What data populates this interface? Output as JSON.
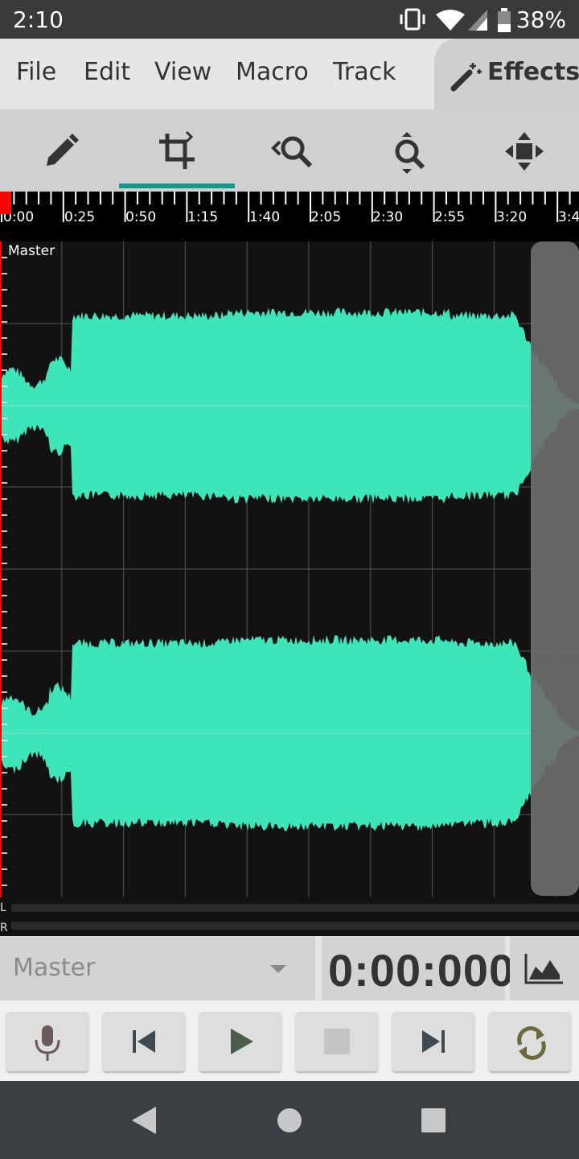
{
  "status_bar": {
    "time": "2:10",
    "battery": "38%"
  },
  "menu": {
    "items": [
      "File",
      "Edit",
      "View",
      "Macro",
      "Track"
    ],
    "effects_label": "Effects"
  },
  "toolbar": {
    "tools": [
      "pencil-icon",
      "crop-icon",
      "zoom-horizontal-icon",
      "zoom-vertical-icon",
      "move-icon"
    ],
    "active_tool_index": 1
  },
  "timeline": {
    "labels": [
      "0:00",
      "0:25",
      "0:50",
      "1:15",
      "1:40",
      "2:05",
      "2:30",
      "2:55",
      "3:20",
      "3:4"
    ]
  },
  "track": {
    "name": "Master"
  },
  "meters": {
    "left": "L",
    "right": "R"
  },
  "controls": {
    "track_select": "Master",
    "time": "0:00:000"
  },
  "transport": [
    "mic-icon",
    "skip-start-icon",
    "play-icon",
    "stop-icon",
    "skip-end-icon",
    "loop-icon"
  ],
  "colors": {
    "waveform": "#3de6b8",
    "accent": "#17998a",
    "playhead": "#ff0000"
  }
}
